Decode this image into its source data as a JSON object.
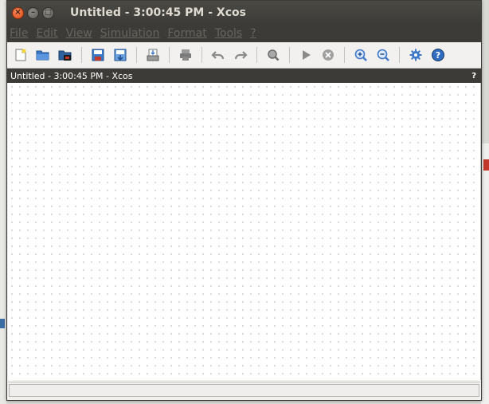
{
  "window": {
    "title": "Untitled - 3:00:45 PM - Xcos",
    "close_glyph": "×",
    "min_glyph": "–",
    "max_glyph": "□"
  },
  "menubar": {
    "items": [
      "File",
      "Edit",
      "View",
      "Simulation",
      "Format",
      "Tools",
      "?"
    ]
  },
  "toolbar": {
    "icons": [
      "new-diagram-icon",
      "open-icon",
      "open-in-scilab-icon",
      "save-icon",
      "save-as-icon",
      "export-icon",
      "print-icon",
      "undo-icon",
      "redo-icon",
      "fit-diagram-icon",
      "start-icon",
      "stop-icon",
      "zoom-in-icon",
      "zoom-out-icon",
      "setup-icon",
      "help-icon"
    ]
  },
  "docbar": {
    "title": "Untitled - 3:00:45 PM - Xcos",
    "help_mark": "?"
  },
  "colors": {
    "titlebar": "#3c3b37",
    "close_button": "#df4a16",
    "canvas": "#ffffff"
  }
}
